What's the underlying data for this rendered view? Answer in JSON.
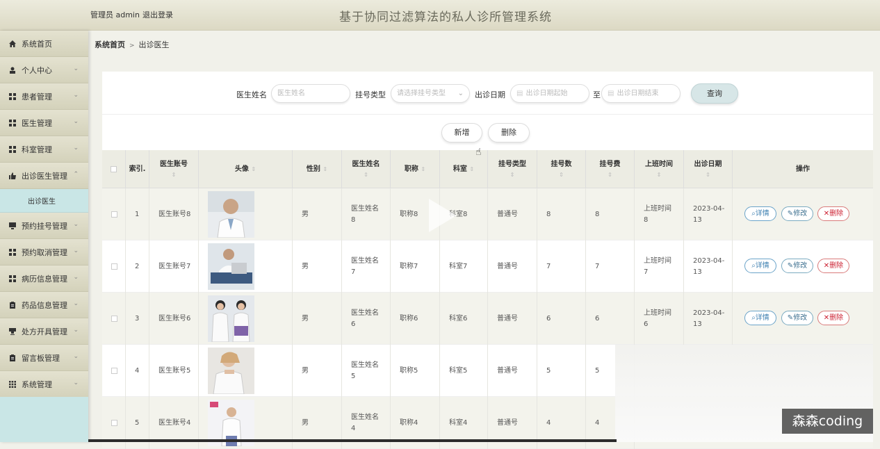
{
  "topbar": {
    "user": "管理员 admin",
    "logout": "退出登录",
    "title": "基于协同过滤算法的私人诊所管理系统"
  },
  "sidebar": {
    "items": [
      {
        "label": "系统首页",
        "icon": "home-icon"
      },
      {
        "label": "个人中心",
        "icon": "user-icon"
      },
      {
        "label": "患者管理",
        "icon": "grid-icon"
      },
      {
        "label": "医生管理",
        "icon": "grid-icon"
      },
      {
        "label": "科室管理",
        "icon": "grid-icon"
      },
      {
        "label": "出诊医生管理",
        "icon": "thumb-icon"
      },
      {
        "label": "预约挂号管理",
        "icon": "monitor-icon"
      },
      {
        "label": "预约取消管理",
        "icon": "grid-icon"
      },
      {
        "label": "病历信息管理",
        "icon": "grid-icon"
      },
      {
        "label": "药品信息管理",
        "icon": "clipboard-icon"
      },
      {
        "label": "处方开具管理",
        "icon": "cup-icon"
      },
      {
        "label": "留言板管理",
        "icon": "clipboard-icon"
      },
      {
        "label": "系统管理",
        "icon": "apps-icon"
      }
    ],
    "submenu_item": "出诊医生"
  },
  "breadcrumb": {
    "home": "系统首页",
    "sep": ">",
    "current": "出诊医生"
  },
  "search": {
    "name_label": "医生姓名",
    "name_placeholder": "医生姓名",
    "type_label": "挂号类型",
    "type_placeholder": "请选择挂号类型",
    "date_label": "出诊日期",
    "date_start_placeholder": "出诊日期起始",
    "to_label": "至",
    "date_end_placeholder": "出诊日期结束",
    "query_button": "查询"
  },
  "actions": {
    "add": "新增",
    "delete": "删除"
  },
  "table": {
    "headers": [
      "索引.",
      "医生账号",
      "头像",
      "性别",
      "医生姓名",
      "职称",
      "科室",
      "挂号类型",
      "挂号数",
      "挂号费",
      "上班时间",
      "出诊日期",
      "操作"
    ],
    "row_buttons": {
      "detail": "详情",
      "edit": "修改",
      "delete": "删除"
    },
    "rows": [
      {
        "index": "1",
        "account": "医生账号8",
        "gender": "男",
        "name_a": "医生姓名",
        "name_b": "8",
        "title": "职称8",
        "dept": "科室8",
        "type": "普通号",
        "count": "8",
        "fee": "8",
        "time_a": "上班时间",
        "time_b": "8",
        "date_a": "2023-04-",
        "date_b": "13"
      },
      {
        "index": "2",
        "account": "医生账号7",
        "gender": "男",
        "name_a": "医生姓名",
        "name_b": "7",
        "title": "职称7",
        "dept": "科室7",
        "type": "普通号",
        "count": "7",
        "fee": "7",
        "time_a": "上班时间",
        "time_b": "7",
        "date_a": "2023-04-",
        "date_b": "13"
      },
      {
        "index": "3",
        "account": "医生账号6",
        "gender": "男",
        "name_a": "医生姓名",
        "name_b": "6",
        "title": "职称6",
        "dept": "科室6",
        "type": "普通号",
        "count": "6",
        "fee": "6",
        "time_a": "上班时间",
        "time_b": "6",
        "date_a": "2023-04-",
        "date_b": "13"
      },
      {
        "index": "4",
        "account": "医生账号5",
        "gender": "男",
        "name_a": "医生姓名",
        "name_b": "5",
        "title": "职称5",
        "dept": "科室5",
        "type": "普通号",
        "count": "5",
        "fee": "5"
      },
      {
        "index": "5",
        "account": "医生账号4",
        "gender": "男",
        "name_a": "医生姓名",
        "name_b": "4",
        "title": "职称4",
        "dept": "科室4",
        "type": "普通号",
        "count": "4",
        "fee": "4"
      }
    ]
  },
  "watermark": "森森coding",
  "colors": {
    "sidebar_bg": "#dad9c5",
    "submenu_bg": "#c9e6e6",
    "query_bg": "#d7e6e7",
    "delete_red": "#cc2233",
    "detail_blue": "#3d7fb0"
  }
}
